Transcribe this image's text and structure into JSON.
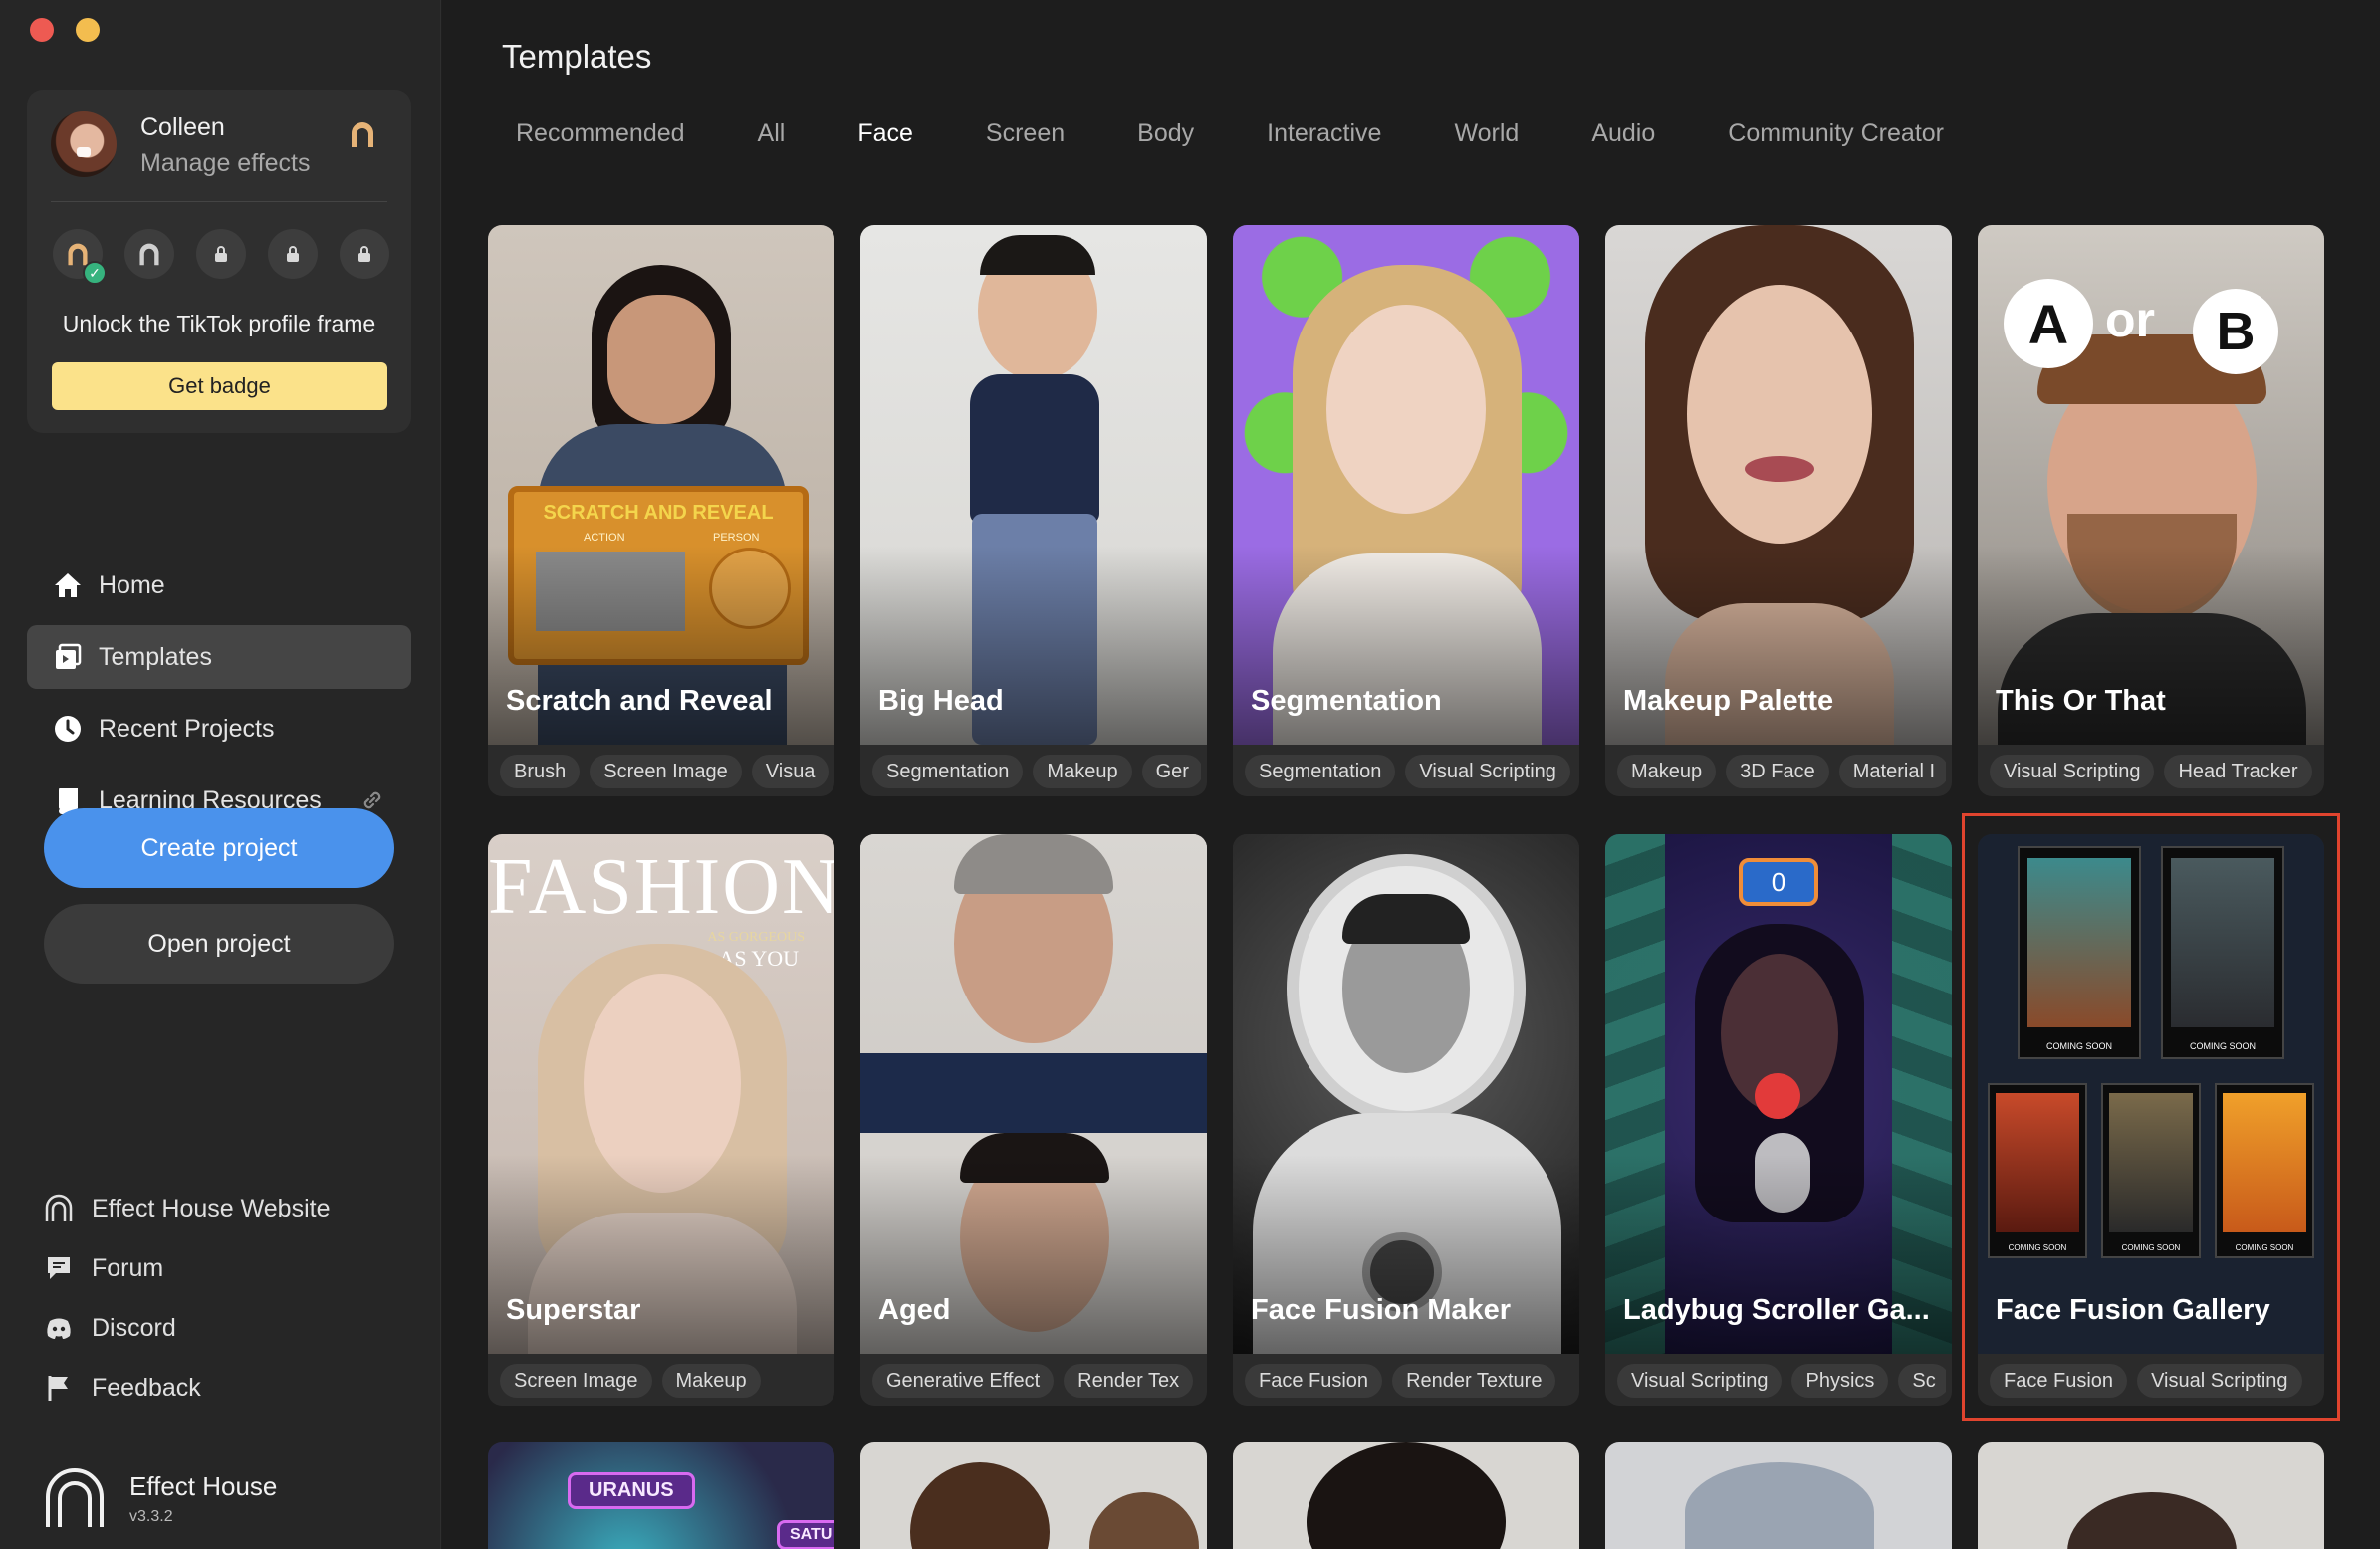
{
  "window": {
    "controls": [
      "close",
      "minimize"
    ]
  },
  "profile": {
    "name": "Colleen",
    "subtitle": "Manage effects",
    "badge_count_locked": 3,
    "unlock_text": "Unlock the TikTok profile frame",
    "get_badge_label": "Get badge"
  },
  "nav": {
    "items": [
      {
        "label": "Home",
        "icon": "home-icon"
      },
      {
        "label": "Templates",
        "icon": "templates-icon",
        "active": true
      },
      {
        "label": "Recent Projects",
        "icon": "clock-icon"
      },
      {
        "label": "Learning Resources",
        "icon": "book-icon"
      }
    ]
  },
  "actions": {
    "create": "Create project",
    "open": "Open project"
  },
  "links": [
    {
      "label": "Effect House Website",
      "icon": "effect-house-icon"
    },
    {
      "label": "Forum",
      "icon": "forum-icon"
    },
    {
      "label": "Discord",
      "icon": "discord-icon"
    },
    {
      "label": "Feedback",
      "icon": "flag-icon"
    }
  ],
  "app": {
    "name": "Effect House",
    "version": "v3.3.2"
  },
  "main": {
    "title": "Templates",
    "tabs": [
      "Recommended",
      "All",
      "Face",
      "Screen",
      "Body",
      "Interactive",
      "World",
      "Audio",
      "Community Creator"
    ],
    "active_tab": "Face",
    "cards": [
      {
        "title": "Scratch and Reveal",
        "tags": [
          "Brush",
          "Screen Image",
          "Visua"
        ],
        "thumb_text": [
          "SCRATCH AND REVEAL",
          "ACTION",
          "PERSON"
        ]
      },
      {
        "title": "Big Head",
        "tags": [
          "Segmentation",
          "Makeup",
          "Ger"
        ]
      },
      {
        "title": "Segmentation",
        "tags": [
          "Segmentation",
          "Visual Scripting"
        ]
      },
      {
        "title": "Makeup Palette",
        "tags": [
          "Makeup",
          "3D Face",
          "Material I"
        ]
      },
      {
        "title": "This Or That",
        "tags": [
          "Visual Scripting",
          "Head Tracker"
        ],
        "thumb_text": [
          "A",
          "or",
          "B"
        ]
      },
      {
        "title": "Superstar",
        "tags": [
          "Screen Image",
          "Makeup"
        ],
        "thumb_text": [
          "FASHION",
          "AS GORGEOUS",
          "AS YOU"
        ]
      },
      {
        "title": "Aged",
        "tags": [
          "Generative Effect",
          "Render Tex"
        ]
      },
      {
        "title": "Face Fusion Maker",
        "tags": [
          "Face Fusion",
          "Render Texture"
        ]
      },
      {
        "title": "Ladybug Scroller  Ga...",
        "tags": [
          "Visual Scripting",
          "Physics",
          "Sc"
        ],
        "thumb_text": [
          "0"
        ]
      },
      {
        "title": "Face Fusion Gallery",
        "tags": [
          "Face Fusion",
          "Visual Scripting"
        ],
        "selected": true,
        "thumb_text": [
          "COMING SOON"
        ]
      }
    ],
    "partial_row_text": [
      "URANUS",
      "SATU"
    ]
  },
  "colors": {
    "accent": "#4a92ec",
    "badge_button": "#fbe28a",
    "selection": "#e0442e"
  }
}
